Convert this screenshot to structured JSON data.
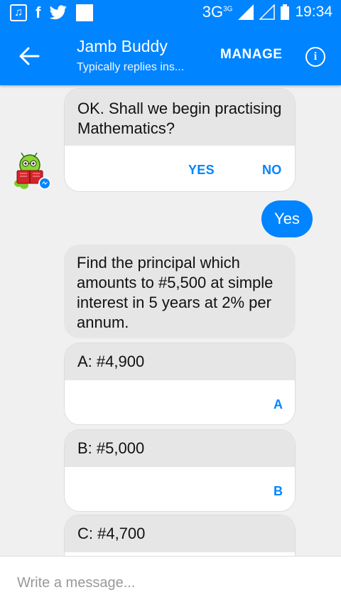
{
  "status_bar": {
    "network": "3G",
    "network_sup": "3G",
    "time": "19:34"
  },
  "header": {
    "title": "Jamb Buddy",
    "subtitle": "Typically replies ins...",
    "manage_label": "MANAGE",
    "info_label": "i"
  },
  "messages": {
    "bot_intro": {
      "text": "OK. Shall we begin practising Mathematics?",
      "replies": [
        "YES",
        "NO"
      ]
    },
    "user_reply": "Yes",
    "question": "Find the principal which amounts to #5,500 at simple interest in 5 years at 2% per annum.",
    "options": [
      {
        "text": "A: #4,900",
        "reply": "A"
      },
      {
        "text": "B: #5,000",
        "reply": "B"
      },
      {
        "text": "C: #4,700",
        "reply": ""
      }
    ]
  },
  "composer": {
    "placeholder": "Write a message..."
  },
  "colors": {
    "accent": "#0084ff",
    "bubble_grey": "#e6e6e6",
    "background": "#f0f0f0"
  }
}
